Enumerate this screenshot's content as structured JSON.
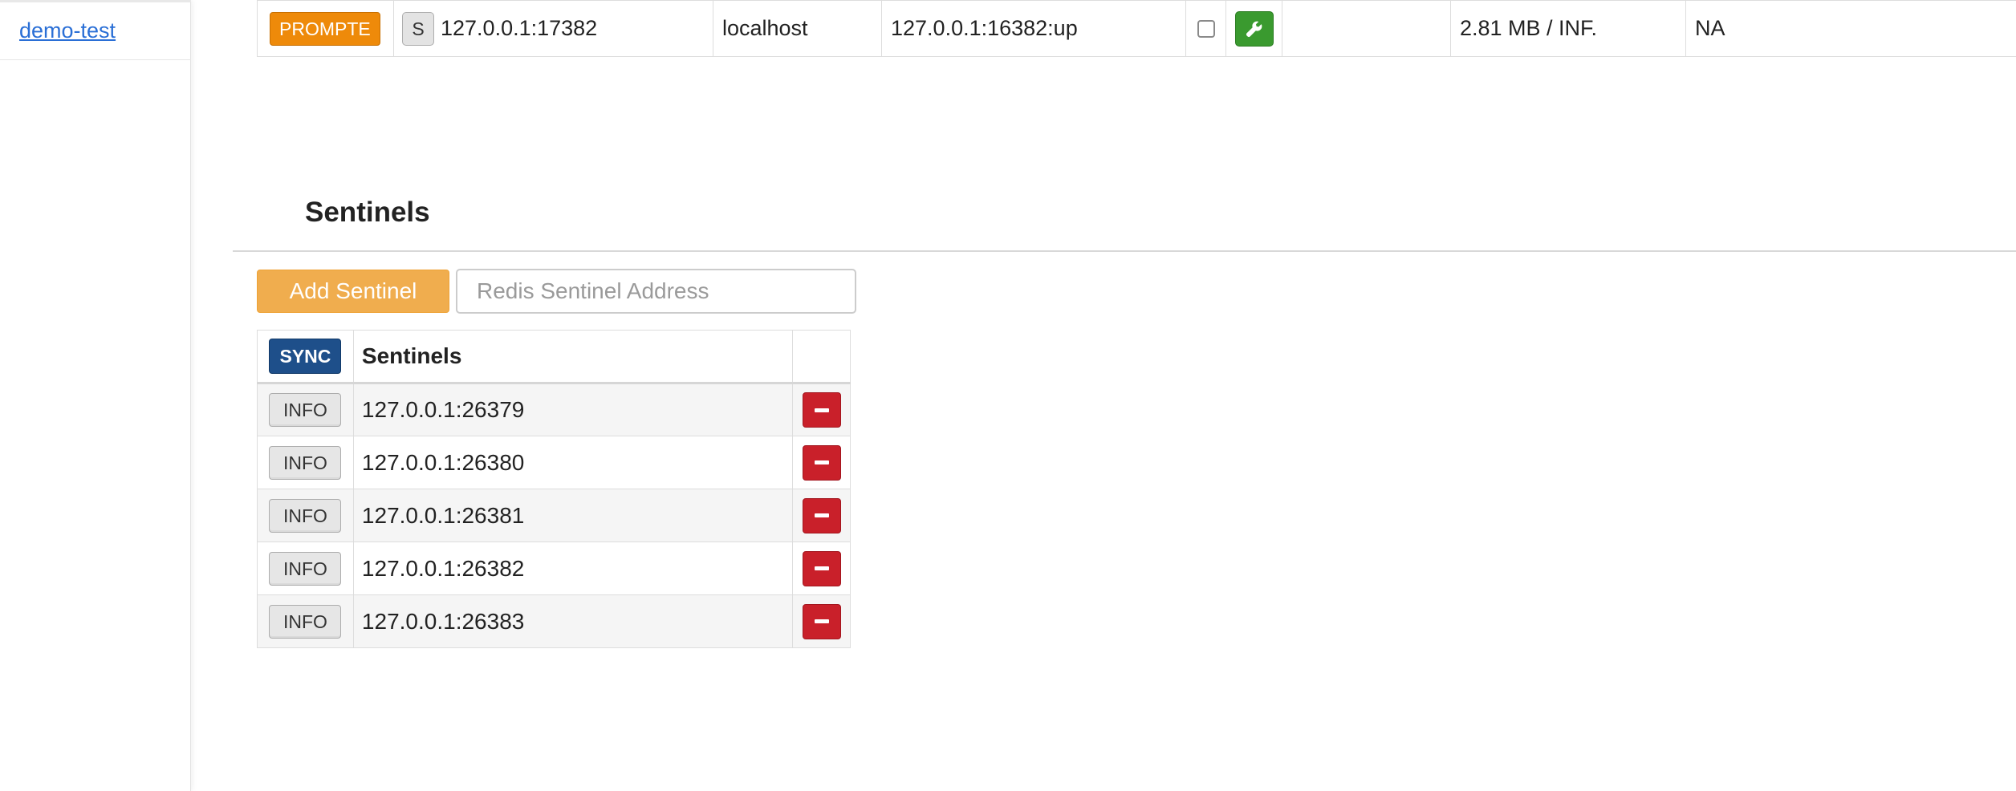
{
  "sidebar": {
    "items": [
      {
        "label": "demo-test"
      }
    ]
  },
  "server_row": {
    "role_button": "PROMPTE",
    "s_button": "S",
    "address": "127.0.0.1:17382",
    "host": "localhost",
    "master_link": "127.0.0.1:16382:up",
    "memory": "2.81 MB / INF.",
    "extra": "NA",
    "colors": {
      "promote": "#ee8a0a",
      "tool": "#3a9a2f"
    }
  },
  "sentinels": {
    "title": "Sentinels",
    "add_button": "Add Sentinel",
    "address_placeholder": "Redis Sentinel Address",
    "table": {
      "sync_button": "SYNC",
      "header": "Sentinels",
      "info_label": "INFO",
      "rows": [
        {
          "address": "127.0.0.1:26379"
        },
        {
          "address": "127.0.0.1:26380"
        },
        {
          "address": "127.0.0.1:26381"
        },
        {
          "address": "127.0.0.1:26382"
        },
        {
          "address": "127.0.0.1:26383"
        }
      ]
    },
    "colors": {
      "add": "#f0ad4e",
      "sync": "#1e4f8a",
      "remove": "#c9202a"
    }
  }
}
